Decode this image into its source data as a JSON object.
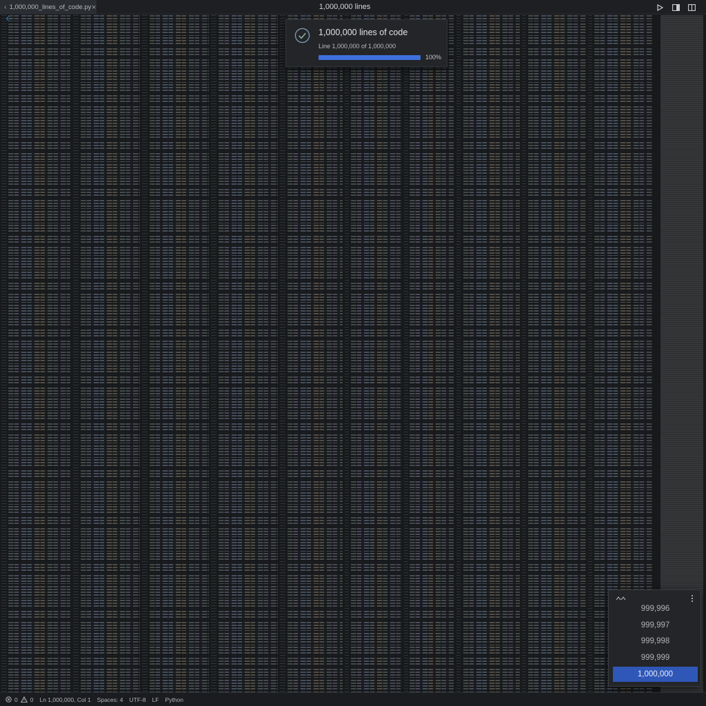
{
  "window": {
    "title": "1,000,000 lines"
  },
  "tab": {
    "filename": "1,000,000_lines_of_code.py",
    "back_glyph": "‹",
    "close_glyph": "×"
  },
  "toolbar": {
    "run_icon": "play-icon",
    "split_icon": "split-editor-icon",
    "book_icon": "book-icon"
  },
  "notification": {
    "title": "1,000,000 lines of code",
    "subtitle": "Line 1,000,000 of 1,000,000",
    "progress_label": "100%",
    "progress": 1.0,
    "icon": "check-circle-icon",
    "accent": "#3e6fdc"
  },
  "line_picker": {
    "items": [
      "999,996",
      "999,997",
      "999,998",
      "999,999"
    ],
    "selected": "1,000,000",
    "selected_color": "#2f57b8"
  },
  "status_bar": {
    "errors": "0",
    "warnings": "0",
    "position": "Ln 1,000,000, Col 1",
    "indent": "Spaces: 4",
    "encoding": "UTF-8",
    "eol": "LF",
    "language": "Python"
  }
}
